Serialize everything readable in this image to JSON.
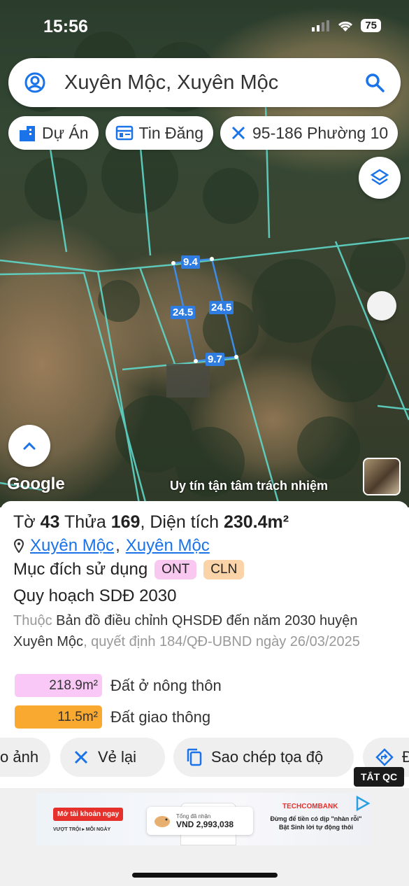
{
  "status_bar": {
    "time": "15:56",
    "battery": "75"
  },
  "search": {
    "query": "Xuyên Mộc, Xuyên Mộc"
  },
  "chips": [
    {
      "label": "Dự Án",
      "icon": "building-icon"
    },
    {
      "label": "Tin Đăng",
      "icon": "listing-icon"
    },
    {
      "label": "95-186 Phường 10",
      "icon": "ruler-icon"
    }
  ],
  "map": {
    "google_label": "Google",
    "slogan": "Uy tín tận tâm trách nhiệm",
    "dimensions": {
      "top": "9.4",
      "left": "24.5",
      "right": "24.5",
      "bottom": "9.7"
    }
  },
  "parcel": {
    "sheet_label": "Tờ",
    "sheet_no": "43",
    "plot_label": "Thửa",
    "plot_no": "169",
    "area_label": "Diện tích",
    "area": "230.4m²",
    "location_commune": "Xuyên Mộc",
    "location_district": "Xuyên Mộc",
    "purpose_label": "Mục đích sử dụng",
    "purpose_tags": [
      {
        "code": "ONT",
        "color": "#f8c8f0"
      },
      {
        "code": "CLN",
        "color": "#fbd3a8"
      }
    ],
    "planning_title": "Quy hoạch SDĐ 2030",
    "planning_prefix": "Thuộc",
    "planning_map": "Bản đồ điều chỉnh QHSDĐ đến năm 2030 huyện Xuyên Mộc",
    "planning_decision": ", quyết định 184/QĐ-UBND ngày 26/03/2025",
    "land_use": [
      {
        "area": "218.9m²",
        "label": "Đất ở nông thôn",
        "color": "#fac8f6"
      },
      {
        "area": "11.5m²",
        "label": "Đất giao thông",
        "color": "#f9a930"
      }
    ]
  },
  "actions": [
    {
      "label": "o ảnh",
      "icon": ""
    },
    {
      "label": "Vẻ lại",
      "icon": "redraw-icon"
    },
    {
      "label": "Sao chép tọa độ",
      "icon": "copy-icon"
    },
    {
      "label": "Đ",
      "icon": "directions-icon"
    }
  ],
  "ad": {
    "close_label": "TẮT QC",
    "cta": "Mở tài khoản ngay",
    "small": "VƯỢT TRỘI ▸ MỖI NGÀY",
    "card_caption": "Tổng đã nhận",
    "card_value": "VND 2,993,038",
    "brand": "TECHCOMBANK",
    "tagline": "Đừng để tiền có dịp \"nhàn rỗi\" Bật Sinh lời tự động thôi"
  },
  "colors": {
    "accent": "#1a73e8",
    "parcel_line": "#3d8de8",
    "boundary": "#5fd6c8"
  }
}
